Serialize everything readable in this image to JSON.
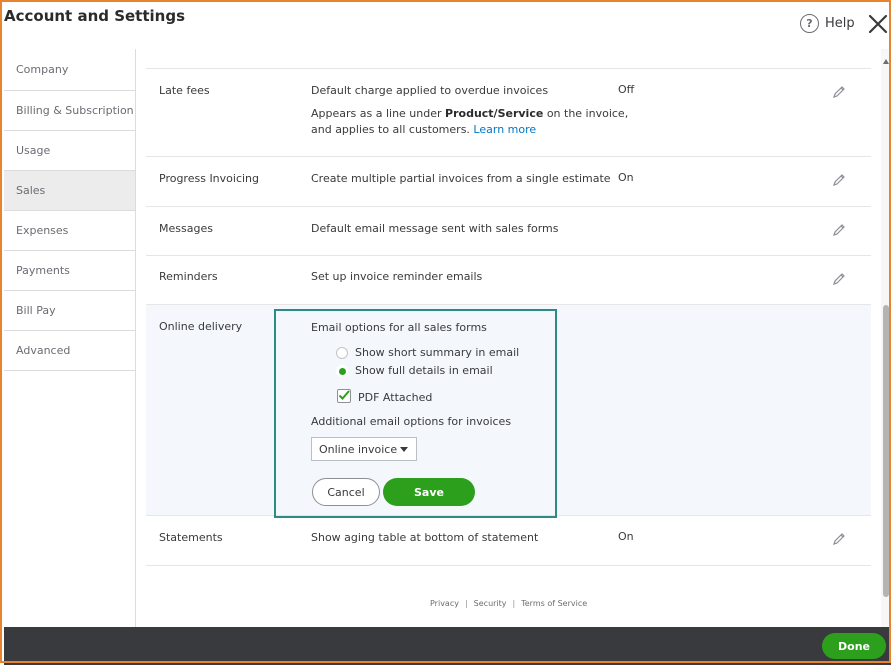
{
  "header": {
    "title": "Account and Settings",
    "help_label": "Help",
    "help_glyph": "?"
  },
  "sidebar": {
    "items": [
      {
        "label": "Company"
      },
      {
        "label": "Billing & Subscription"
      },
      {
        "label": "Usage"
      },
      {
        "label": "Sales"
      },
      {
        "label": "Expenses"
      },
      {
        "label": "Payments"
      },
      {
        "label": "Bill Pay"
      },
      {
        "label": "Advanced"
      }
    ],
    "active": "Sales"
  },
  "settings": {
    "late_fees": {
      "label": "Late fees",
      "description": "Default charge applied to overdue invoices",
      "value": "Off",
      "note_prefix": "Appears as a line under",
      "note_bold": "Product/Service",
      "note_suffix": "on the invoice,",
      "note_line2": "and applies to all customers.",
      "learn_more": "Learn more"
    },
    "progress_invoicing": {
      "label": "Progress Invoicing",
      "description": "Create multiple partial invoices from a single estimate",
      "value": "On"
    },
    "messages": {
      "label": "Messages",
      "description": "Default email message sent with sales forms"
    },
    "reminders": {
      "label": "Reminders",
      "description": "Set up invoice reminder emails"
    },
    "online_delivery": {
      "label": "Online delivery",
      "email_options_heading": "Email options for all sales forms",
      "option_summary": "Show short summary in email",
      "option_full": "Show full details in email",
      "selected_option": "Show full details in email",
      "pdf_attached_label": "PDF Attached",
      "pdf_attached_checked": true,
      "additional_heading": "Additional email options for invoices",
      "invoice_option_value": "Online invoice",
      "cancel_label": "Cancel",
      "save_label": "Save"
    },
    "statements": {
      "label": "Statements",
      "description": "Show aging table at bottom of statement",
      "value": "On"
    }
  },
  "footer": {
    "privacy": "Privacy",
    "security": "Security",
    "terms": "Terms of Service"
  },
  "bottom_bar": {
    "done_label": "Done"
  },
  "colors": {
    "accent_green": "#2ca01c",
    "panel_border": "#2e8b83",
    "frame": "#e8832f",
    "link": "#0077c5"
  }
}
